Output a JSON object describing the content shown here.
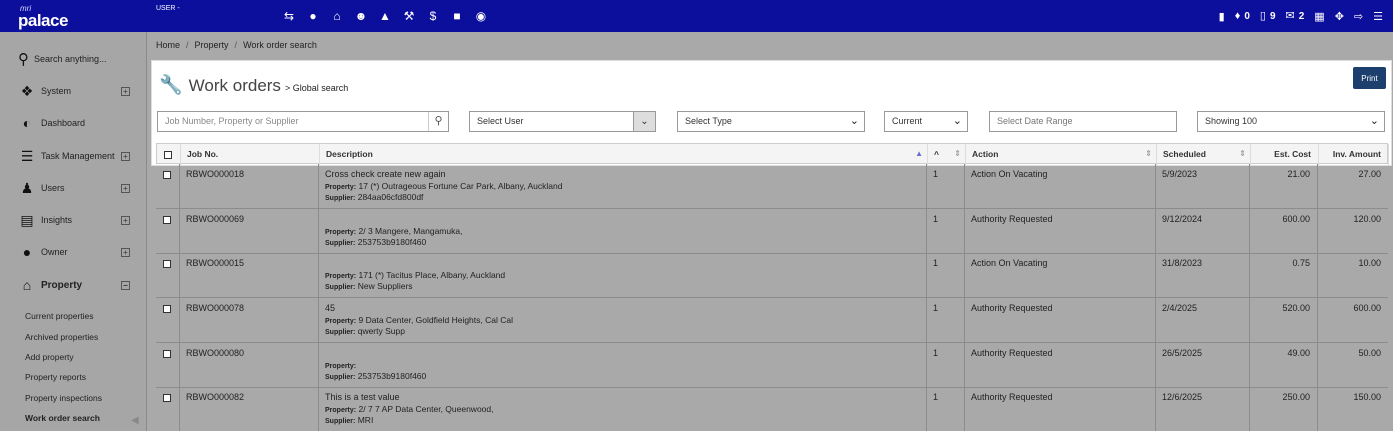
{
  "app": {
    "logo_prefix": "mri",
    "logo_name": "palace",
    "user_label": "USER -"
  },
  "nav": {
    "icons": [
      "transfer-icon",
      "user-icon",
      "home-icon",
      "users-icon",
      "contacts-icon",
      "wrench-icon",
      "dollar-icon",
      "lock-icon",
      "eye-icon"
    ]
  },
  "header_right": {
    "notifications": "0",
    "documents": "9",
    "messages": "2"
  },
  "sidebar": {
    "search_placeholder": "Search anything...",
    "items": [
      {
        "label": "System"
      },
      {
        "label": "Dashboard"
      },
      {
        "label": "Task Management"
      },
      {
        "label": "Users"
      },
      {
        "label": "Insights"
      },
      {
        "label": "Owner"
      },
      {
        "label": "Property"
      }
    ],
    "subitems": [
      "Current properties",
      "Archived properties",
      "Add property",
      "Property reports",
      "Property inspections",
      "Work order search"
    ]
  },
  "breadcrumb": [
    "Home",
    "Property",
    "Work order search"
  ],
  "panel": {
    "title": "Work orders",
    "subtitle": "> Global search",
    "print_label": "Print"
  },
  "filters": {
    "search_placeholder": "Job Number, Property or Supplier",
    "user": "Select User",
    "type": "Select Type",
    "current": "Current",
    "date_placeholder": "Select Date Range",
    "showing": "Showing 100"
  },
  "table": {
    "headers": [
      "Job No.",
      "Description",
      "^",
      "Action",
      "Scheduled",
      "Est. Cost",
      "Inv. Amount"
    ],
    "property_label": "Property:",
    "supplier_label": "Supplier:",
    "rows": [
      {
        "job": "RBWO000018",
        "desc": "Cross check create new again",
        "property": "17 (*) Outrageous Fortune Car Park, Albany, Auckland",
        "supplier": "284aa06cfd800df",
        "n": "1",
        "action": "Action On Vacating",
        "scheduled": "5/9/2023",
        "est": "21.00",
        "inv": "27.00"
      },
      {
        "job": "RBWO000069",
        "desc": "",
        "property": "2/ 3 Mangere, Mangamuka,",
        "supplier": "253753b9180f460",
        "n": "1",
        "action": "Authority Requested",
        "scheduled": "9/12/2024",
        "est": "600.00",
        "inv": "120.00"
      },
      {
        "job": "RBWO000015",
        "desc": "",
        "property": "171 (*) Tacitus Place, Albany, Auckland",
        "supplier": "New Suppliers",
        "n": "1",
        "action": "Action On Vacating",
        "scheduled": "31/8/2023",
        "est": "0.75",
        "inv": "10.00"
      },
      {
        "job": "RBWO000078",
        "desc": "45",
        "property": "9 Data Center, Goldfield Heights, Cal Cal",
        "supplier": "qwerty Supp",
        "n": "1",
        "action": "Authority Requested",
        "scheduled": "2/4/2025",
        "est": "520.00",
        "inv": "600.00"
      },
      {
        "job": "RBWO000080",
        "desc": "",
        "property": "",
        "supplier": "253753b9180f460",
        "n": "1",
        "action": "Authority Requested",
        "scheduled": "26/5/2025",
        "est": "49.00",
        "inv": "50.00"
      },
      {
        "job": "RBWO000082",
        "desc": "This is a test value",
        "property": "2/ 7 7 AP Data Center, Queenwood,",
        "supplier": "MRI",
        "n": "1",
        "action": "Authority Requested",
        "scheduled": "12/6/2025",
        "est": "250.00",
        "inv": "150.00"
      }
    ]
  }
}
